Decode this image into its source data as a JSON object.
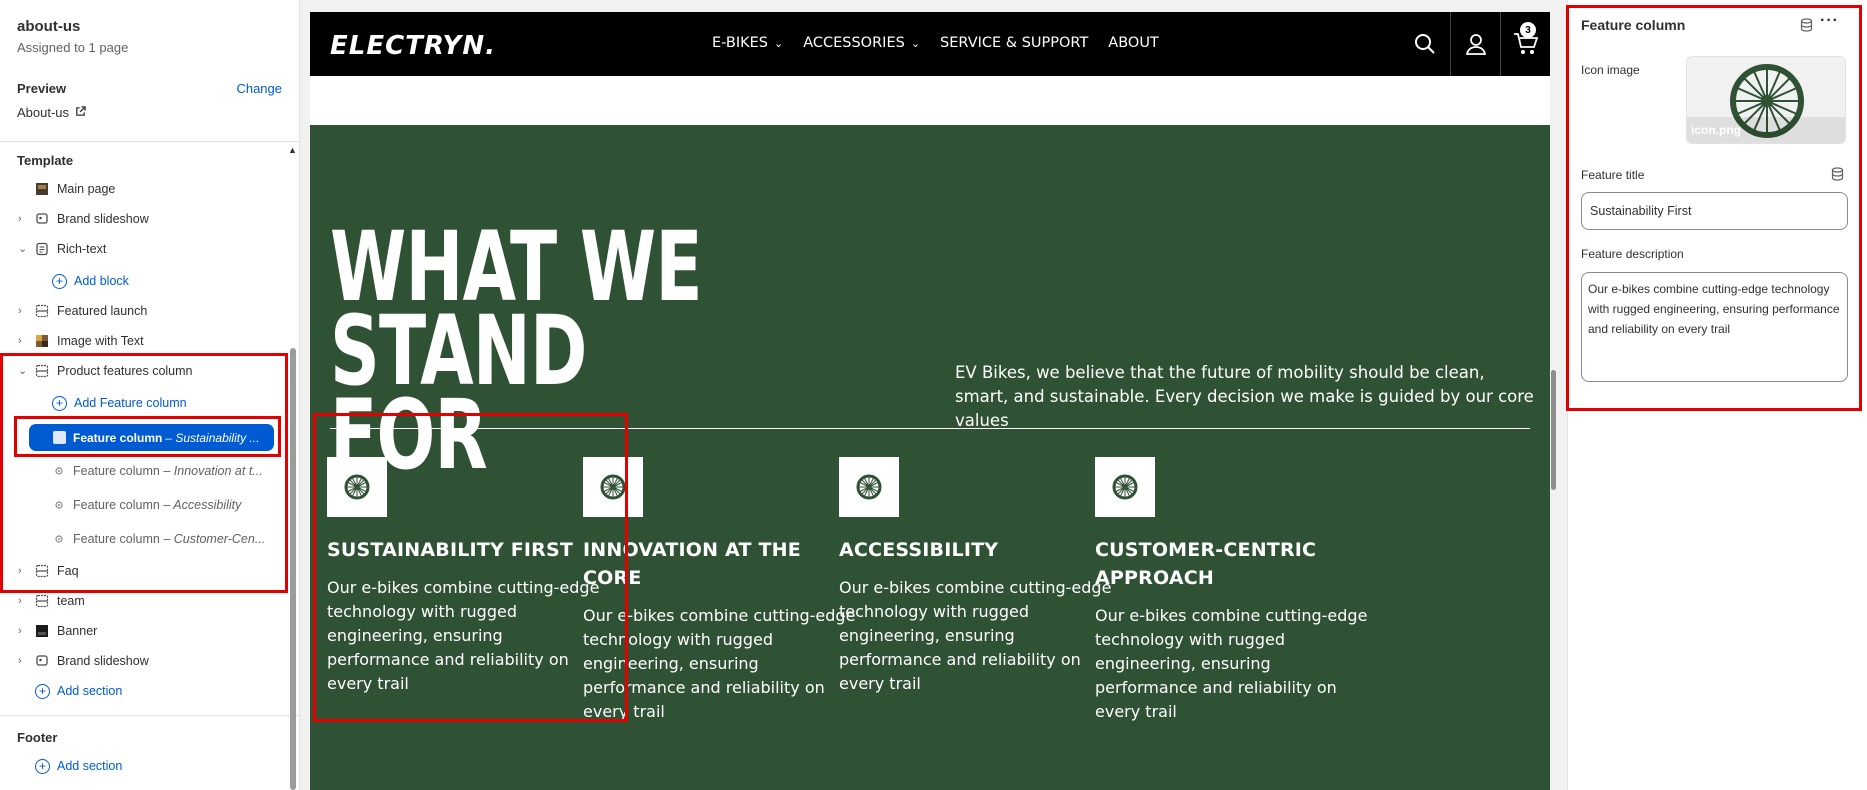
{
  "sidebar": {
    "title": "about-us",
    "subtitle": "Assigned to 1 page",
    "preview_label": "Preview",
    "change_label": "Change",
    "preview_page": "About-us",
    "template_label": "Template",
    "items": {
      "main_page": "Main page",
      "brand_slideshow": "Brand slideshow",
      "rich_text": "Rich-text",
      "add_block": "Add block",
      "featured_launch": "Featured launch",
      "image_with_text": "Image with Text",
      "product_features_column": "Product features column",
      "add_feature_column": "Add Feature column",
      "feature_column_label": "Feature column",
      "fc_selected_suffix": "– Sustainability ...",
      "fc_innovation_suffix": "– Innovation at t...",
      "fc_accessibility_suffix": "– Accessibility",
      "fc_customer_suffix": "– Customer-Cen...",
      "faq": "Faq",
      "team": "team",
      "banner": "Banner",
      "brand_slideshow_2": "Brand slideshow",
      "add_section": "Add section",
      "footer_label": "Footer",
      "footer_add_section": "Add section"
    }
  },
  "store": {
    "logo": "ELECTRYN.",
    "nav": {
      "ebikes": "E-BIKES",
      "accessories": "ACCESSORIES",
      "service": "SERVICE & SUPPORT",
      "about": "ABOUT"
    },
    "cart_count": "3",
    "hero": {
      "title": "WHAT WE STAND FOR",
      "text": "EV Bikes, we believe that the future of mobility should be clean, smart, and sustainable. Every decision we make is guided by our core values"
    },
    "features": [
      {
        "title": "SUSTAINABILITY FIRST",
        "desc": "Our e-bikes combine cutting-edge technology with rugged engineering, ensuring performance and reliability on every trail"
      },
      {
        "title": "INNOVATION AT THE CORE",
        "desc": "Our e-bikes combine cutting-edge technology with rugged engineering, ensuring performance and reliability on every trail"
      },
      {
        "title": "ACCESSIBILITY",
        "desc": "Our e-bikes combine cutting-edge technology with rugged engineering, ensuring performance and reliability on every trail"
      },
      {
        "title": "CUSTOMER-CENTRIC APPROACH",
        "desc": "Our e-bikes combine cutting-edge technology with rugged engineering, ensuring performance and reliability on every trail"
      }
    ]
  },
  "panel": {
    "title": "Feature column",
    "icon_image_label": "Icon image",
    "icon_file": "icon.png",
    "feature_title_label": "Feature title",
    "feature_title_value": "Sustainability First",
    "feature_desc_label": "Feature description",
    "feature_desc_value": "Our e-bikes combine cutting-edge technology with rugged engineering, ensuring performance and reliability on every trail"
  },
  "colors": {
    "accent": "#005bd3",
    "hero_bg": "#2f5234",
    "highlight": "#e30000"
  }
}
